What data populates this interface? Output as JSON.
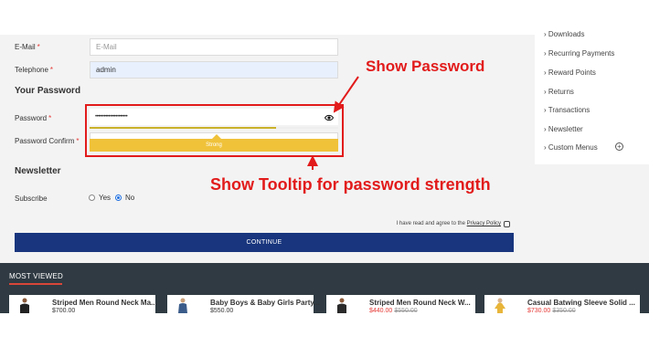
{
  "form": {
    "email_label": "E-Mail",
    "email_placeholder": "E-Mail",
    "telephone_label": "Telephone",
    "telephone_value": "admin",
    "password_section_title": "Your Password",
    "password_label": "Password",
    "password_value": "••••••••••••••••••••••",
    "password_confirm_label": "Password Confirm",
    "required_mark": "*",
    "strength_fraction": 0.75,
    "strength_tooltip": "Strong",
    "newsletter_title": "Newsletter",
    "subscribe_label": "Subscribe",
    "yes_label": "Yes",
    "no_label": "No",
    "subscribe_selected": "No",
    "agree_text": "I have read and agree to the",
    "privacy_link": "Privacy Policy",
    "continue_label": "CONTINUE"
  },
  "sidebar": {
    "items": [
      {
        "label": "Downloads"
      },
      {
        "label": "Recurring Payments"
      },
      {
        "label": "Reward Points"
      },
      {
        "label": "Returns"
      },
      {
        "label": "Transactions"
      },
      {
        "label": "Newsletter"
      },
      {
        "label": "Custom Menus"
      }
    ],
    "chevron": "›"
  },
  "most_viewed": {
    "title": "MOST VIEWED",
    "products": [
      {
        "name": "Striped Men Round Neck Ma...",
        "price": "$700.00",
        "old_price": ""
      },
      {
        "name": "Baby Boys & Baby Girls Party...",
        "price": "$550.00",
        "old_price": ""
      },
      {
        "name": "Striped Men Round Neck W...",
        "price": "$440.00",
        "old_price": "$550.00"
      },
      {
        "name": "Casual Batwing Sleeve Solid ...",
        "price": "$730.00",
        "old_price": "$350.00"
      }
    ]
  },
  "annotations": {
    "show_password": "Show Password",
    "show_tooltip": "Show Tooltip for password strength"
  },
  "colors": {
    "accent_red": "#e21b1b",
    "button_blue": "#18357d",
    "strength_yellow": "#f0c23a",
    "footer_dark": "#2f3a42"
  }
}
